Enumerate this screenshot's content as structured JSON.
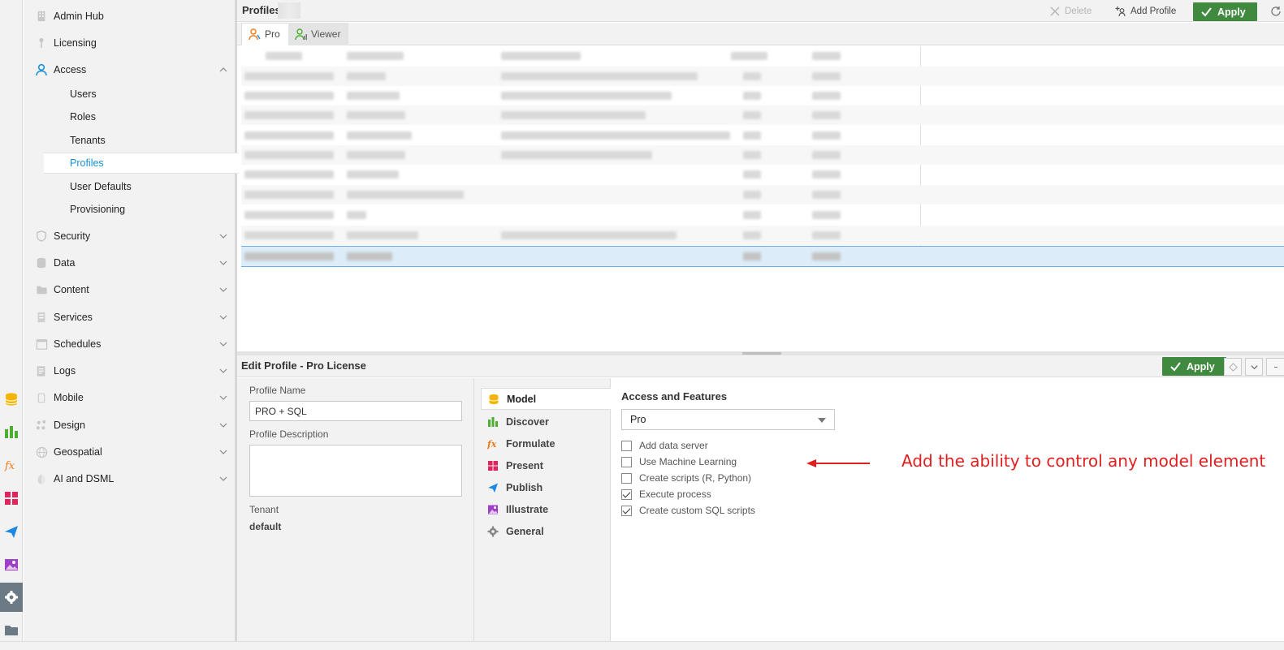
{
  "rail": {
    "icons": [
      "database-icon",
      "bar-chart-icon",
      "fx-icon",
      "grid-icon",
      "paper-plane-icon",
      "image-icon",
      "gear-icon",
      "folder-icon"
    ]
  },
  "nav": {
    "items": [
      {
        "label": "Admin Hub",
        "icon": "building-icon"
      },
      {
        "label": "Licensing",
        "icon": "key-icon"
      },
      {
        "label": "Access",
        "icon": "user-icon",
        "expanded": true
      },
      {
        "label": "Security",
        "icon": "shield-icon"
      },
      {
        "label": "Data",
        "icon": "database-icon"
      },
      {
        "label": "Content",
        "icon": "folder-icon"
      },
      {
        "label": "Services",
        "icon": "server-icon"
      },
      {
        "label": "Schedules",
        "icon": "calendar-icon"
      },
      {
        "label": "Logs",
        "icon": "log-icon"
      },
      {
        "label": "Mobile",
        "icon": "mobile-icon"
      },
      {
        "label": "Design",
        "icon": "palette-icon"
      },
      {
        "label": "Geospatial",
        "icon": "globe-icon"
      },
      {
        "label": "AI and DSML",
        "icon": "ai-icon"
      }
    ],
    "access_sub": [
      "Users",
      "Roles",
      "Tenants",
      "Profiles",
      "User Defaults",
      "Provisioning"
    ],
    "active_sub": "Profiles"
  },
  "profiles": {
    "title": "Profiles",
    "toolbar": {
      "delete": "Delete",
      "add": "Add Profile",
      "apply": "Apply"
    },
    "tabs": [
      {
        "label": "Pro"
      },
      {
        "label": "Viewer"
      }
    ]
  },
  "edit": {
    "title": "Edit Profile - Pro License",
    "apply": "Apply",
    "profile_name_label": "Profile Name",
    "profile_name": "PRO + SQL",
    "profile_desc_label": "Profile Description",
    "profile_desc": "",
    "tenant_label": "Tenant",
    "tenant": "default",
    "modules": [
      {
        "label": "Model",
        "icon": "database-icon",
        "color": "#f5b400"
      },
      {
        "label": "Discover",
        "icon": "bar-chart-icon",
        "color": "#4caf30"
      },
      {
        "label": "Formulate",
        "icon": "fx-icon",
        "color": "#f07a1a"
      },
      {
        "label": "Present",
        "icon": "grid-icon",
        "color": "#e0245e"
      },
      {
        "label": "Publish",
        "icon": "paper-plane-icon",
        "color": "#1e88e5"
      },
      {
        "label": "Illustrate",
        "icon": "image-icon",
        "color": "#a040c8"
      },
      {
        "label": "General",
        "icon": "gear-icon",
        "color": "#777777"
      }
    ],
    "access_title": "Access and Features",
    "access_select": "Pro",
    "features": [
      {
        "label": "Add data server",
        "checked": false
      },
      {
        "label": "Use Machine Learning",
        "checked": false
      },
      {
        "label": "Create scripts (R, Python)",
        "checked": false
      },
      {
        "label": "Execute process",
        "checked": true
      },
      {
        "label": "Create custom SQL scripts",
        "checked": true
      }
    ]
  },
  "annotation": "Add the ability to control any model element",
  "colors": {
    "accent": "#1a8fd8",
    "apply_green": "#3f8a3f",
    "annotation_red": "#e02020"
  }
}
